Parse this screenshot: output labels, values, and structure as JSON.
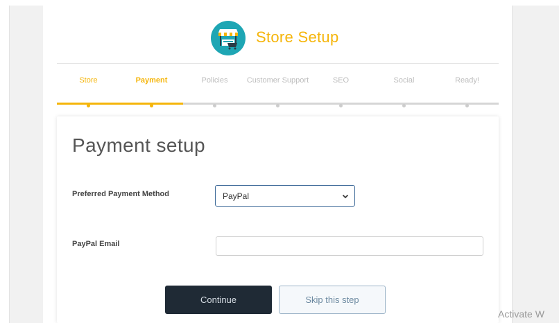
{
  "app": {
    "title": "Store Setup",
    "logo_icon": "storefront-icon"
  },
  "steps": [
    {
      "label": "Store",
      "state": "done"
    },
    {
      "label": "Payment",
      "state": "active"
    },
    {
      "label": "Policies",
      "state": "pending"
    },
    {
      "label": "Customer Support",
      "state": "pending"
    },
    {
      "label": "SEO",
      "state": "pending"
    },
    {
      "label": "Social",
      "state": "pending"
    },
    {
      "label": "Ready!",
      "state": "pending"
    }
  ],
  "progress": {
    "completed_fraction": 0.286
  },
  "form": {
    "title": "Payment setup",
    "payment_method_label": "Preferred Payment Method",
    "payment_method_value": "PayPal",
    "paypal_email_label": "PayPal Email",
    "paypal_email_value": ""
  },
  "actions": {
    "continue_label": "Continue",
    "skip_label": "Skip this step"
  },
  "watermark": "Activate W",
  "colors": {
    "accent": "#f5b50a",
    "logo_bg": "#1ea6b4",
    "primary_button": "#1f2a35"
  }
}
